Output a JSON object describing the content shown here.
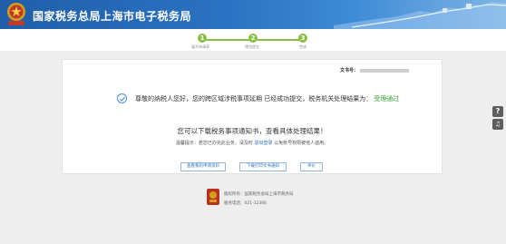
{
  "header": {
    "title": "国家税务总局上海市电子税务局",
    "emblem_text": "税务"
  },
  "steps": [
    {
      "number": "1",
      "label": "填写申请表"
    },
    {
      "number": "2",
      "label": "预览提交"
    },
    {
      "number": "3",
      "label": "完成"
    }
  ],
  "card": {
    "doc_label": "文书号：",
    "message_prefix": "尊敬的纳税人您好，您的跨区域涉税事项延期 已经成功提交，税务机关处理结果为：",
    "status": "受理通过",
    "download_text": "您可以下载税务事项通知书，查看具体处理结果！",
    "tip_prefix": "温馨提示：若您已办完此业务，请及时",
    "tip_link": "退出登录",
    "tip_suffix": "以免账号权限被他人盗用。",
    "buttons": {
      "view": "查看我的申请资料",
      "download": "下载打印文书通知",
      "evaluate": "评价"
    }
  },
  "footer": {
    "copyright": "版权所有：国家税务总局上海市税务局",
    "phone": "服务电话：021-12366"
  },
  "side_tools": {
    "help": "?",
    "support": "♫"
  },
  "colors": {
    "header_blue": "#2a73c2",
    "step_green": "#88bf44",
    "status_green": "#3aa33a",
    "link_blue": "#2a72c4"
  }
}
